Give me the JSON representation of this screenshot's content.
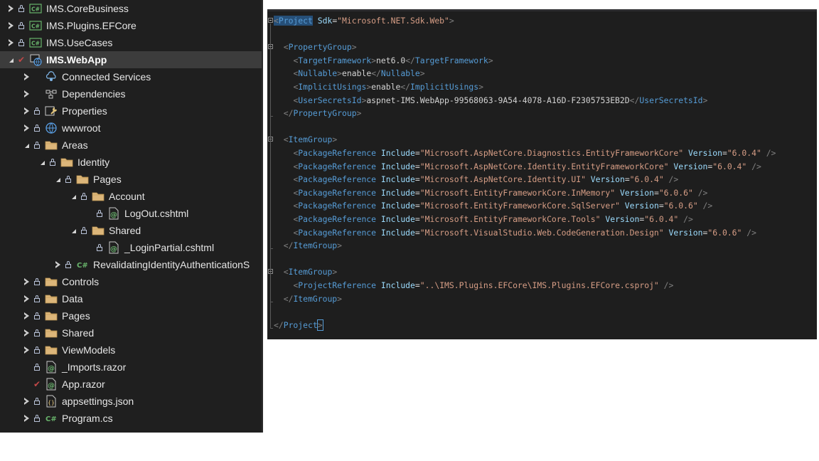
{
  "explorer": {
    "items": [
      {
        "label": "IMS.CoreBusiness",
        "depth": 0,
        "state": "collapsed",
        "mark": "lock",
        "icon": "csharp-project-icon"
      },
      {
        "label": "IMS.Plugins.EFCore",
        "depth": 0,
        "state": "collapsed",
        "mark": "lock",
        "icon": "csharp-project-icon"
      },
      {
        "label": "IMS.UseCases",
        "depth": 0,
        "state": "collapsed",
        "mark": "lock",
        "icon": "csharp-project-icon"
      },
      {
        "label": "IMS.WebApp",
        "depth": 0,
        "state": "expanded",
        "mark": "check",
        "icon": "web-project-icon",
        "selected": true
      },
      {
        "label": "Connected Services",
        "depth": 1,
        "state": "collapsed",
        "mark": "none",
        "icon": "connected-services-icon"
      },
      {
        "label": "Dependencies",
        "depth": 1,
        "state": "collapsed",
        "mark": "none",
        "icon": "dependencies-icon"
      },
      {
        "label": "Properties",
        "depth": 1,
        "state": "collapsed",
        "mark": "lock",
        "icon": "properties-wrench-icon"
      },
      {
        "label": "wwwroot",
        "depth": 1,
        "state": "collapsed",
        "mark": "lock",
        "icon": "globe-icon"
      },
      {
        "label": "Areas",
        "depth": 1,
        "state": "expanded",
        "mark": "lock",
        "icon": "folder-icon"
      },
      {
        "label": "Identity",
        "depth": 2,
        "state": "expanded",
        "mark": "lock",
        "icon": "folder-icon"
      },
      {
        "label": "Pages",
        "depth": 3,
        "state": "expanded",
        "mark": "lock",
        "icon": "folder-icon"
      },
      {
        "label": "Account",
        "depth": 4,
        "state": "expanded",
        "mark": "lock",
        "icon": "folder-icon"
      },
      {
        "label": "LogOut.cshtml",
        "depth": 5,
        "state": "none",
        "mark": "lock",
        "icon": "razor-file-icon"
      },
      {
        "label": "Shared",
        "depth": 4,
        "state": "expanded",
        "mark": "lock",
        "icon": "folder-icon"
      },
      {
        "label": "_LoginPartial.cshtml",
        "depth": 5,
        "state": "none",
        "mark": "lock",
        "icon": "razor-file-icon"
      },
      {
        "label": "RevalidatingIdentityAuthenticationS",
        "depth": 3,
        "state": "collapsed",
        "mark": "lock",
        "icon": "csharp-file-icon"
      },
      {
        "label": "Controls",
        "depth": 1,
        "state": "collapsed",
        "mark": "lock",
        "icon": "folder-icon"
      },
      {
        "label": "Data",
        "depth": 1,
        "state": "collapsed",
        "mark": "lock",
        "icon": "folder-icon"
      },
      {
        "label": "Pages",
        "depth": 1,
        "state": "collapsed",
        "mark": "lock",
        "icon": "folder-icon"
      },
      {
        "label": "Shared",
        "depth": 1,
        "state": "collapsed",
        "mark": "lock",
        "icon": "folder-icon"
      },
      {
        "label": "ViewModels",
        "depth": 1,
        "state": "collapsed",
        "mark": "lock",
        "icon": "folder-icon"
      },
      {
        "label": "_Imports.razor",
        "depth": 1,
        "state": "none",
        "mark": "lock",
        "icon": "razor-file-icon"
      },
      {
        "label": "App.razor",
        "depth": 1,
        "state": "none",
        "mark": "check",
        "icon": "razor-file-icon"
      },
      {
        "label": "appsettings.json",
        "depth": 1,
        "state": "collapsed",
        "mark": "lock",
        "icon": "json-file-icon"
      },
      {
        "label": "Program.cs",
        "depth": 1,
        "state": "collapsed",
        "mark": "lock",
        "icon": "csharp-file-icon"
      }
    ]
  },
  "editor": {
    "lines": [
      [
        [
          "br",
          "<"
        ],
        [
          "tag",
          "Project"
        ],
        [
          "txt",
          " "
        ],
        [
          "attr",
          "Sdk"
        ],
        [
          "eq",
          "="
        ],
        [
          "str",
          "\"Microsoft.NET.Sdk.Web\""
        ],
        [
          "br",
          ">"
        ]
      ],
      [],
      [
        [
          "txt",
          "  "
        ],
        [
          "br",
          "<"
        ],
        [
          "tag",
          "PropertyGroup"
        ],
        [
          "br",
          ">"
        ]
      ],
      [
        [
          "txt",
          "    "
        ],
        [
          "br",
          "<"
        ],
        [
          "tag",
          "TargetFramework"
        ],
        [
          "br",
          ">"
        ],
        [
          "txt",
          "net6.0"
        ],
        [
          "br",
          "</"
        ],
        [
          "tag",
          "TargetFramework"
        ],
        [
          "br",
          ">"
        ]
      ],
      [
        [
          "txt",
          "    "
        ],
        [
          "br",
          "<"
        ],
        [
          "tag",
          "Nullable"
        ],
        [
          "br",
          ">"
        ],
        [
          "txt",
          "enable"
        ],
        [
          "br",
          "</"
        ],
        [
          "tag",
          "Nullable"
        ],
        [
          "br",
          ">"
        ]
      ],
      [
        [
          "txt",
          "    "
        ],
        [
          "br",
          "<"
        ],
        [
          "tag",
          "ImplicitUsings"
        ],
        [
          "br",
          ">"
        ],
        [
          "txt",
          "enable"
        ],
        [
          "br",
          "</"
        ],
        [
          "tag",
          "ImplicitUsings"
        ],
        [
          "br",
          ">"
        ]
      ],
      [
        [
          "txt",
          "    "
        ],
        [
          "br",
          "<"
        ],
        [
          "tag",
          "UserSecretsId"
        ],
        [
          "br",
          ">"
        ],
        [
          "txt",
          "aspnet-IMS.WebApp-99568063-9A54-4078-A16D-F2305753EB2D"
        ],
        [
          "br",
          "</"
        ],
        [
          "tag",
          "UserSecretsId"
        ],
        [
          "br",
          ">"
        ]
      ],
      [
        [
          "txt",
          "  "
        ],
        [
          "br",
          "</"
        ],
        [
          "tag",
          "PropertyGroup"
        ],
        [
          "br",
          ">"
        ]
      ],
      [],
      [
        [
          "txt",
          "  "
        ],
        [
          "br",
          "<"
        ],
        [
          "tag",
          "ItemGroup"
        ],
        [
          "br",
          ">"
        ]
      ],
      [
        [
          "txt",
          "    "
        ],
        [
          "br",
          "<"
        ],
        [
          "tag",
          "PackageReference"
        ],
        [
          "txt",
          " "
        ],
        [
          "attr",
          "Include"
        ],
        [
          "eq",
          "="
        ],
        [
          "str",
          "\"Microsoft.AspNetCore.Diagnostics.EntityFrameworkCore\""
        ],
        [
          "txt",
          " "
        ],
        [
          "attr",
          "Version"
        ],
        [
          "eq",
          "="
        ],
        [
          "str",
          "\"6.0.4\""
        ],
        [
          "txt",
          " "
        ],
        [
          "br",
          "/>"
        ]
      ],
      [
        [
          "txt",
          "    "
        ],
        [
          "br",
          "<"
        ],
        [
          "tag",
          "PackageReference"
        ],
        [
          "txt",
          " "
        ],
        [
          "attr",
          "Include"
        ],
        [
          "eq",
          "="
        ],
        [
          "str",
          "\"Microsoft.AspNetCore.Identity.EntityFrameworkCore\""
        ],
        [
          "txt",
          " "
        ],
        [
          "attr",
          "Version"
        ],
        [
          "eq",
          "="
        ],
        [
          "str",
          "\"6.0.4\""
        ],
        [
          "txt",
          " "
        ],
        [
          "br",
          "/>"
        ]
      ],
      [
        [
          "txt",
          "    "
        ],
        [
          "br",
          "<"
        ],
        [
          "tag",
          "PackageReference"
        ],
        [
          "txt",
          " "
        ],
        [
          "attr",
          "Include"
        ],
        [
          "eq",
          "="
        ],
        [
          "str",
          "\"Microsoft.AspNetCore.Identity.UI\""
        ],
        [
          "txt",
          " "
        ],
        [
          "attr",
          "Version"
        ],
        [
          "eq",
          "="
        ],
        [
          "str",
          "\"6.0.4\""
        ],
        [
          "txt",
          " "
        ],
        [
          "br",
          "/>"
        ]
      ],
      [
        [
          "txt",
          "    "
        ],
        [
          "br",
          "<"
        ],
        [
          "tag",
          "PackageReference"
        ],
        [
          "txt",
          " "
        ],
        [
          "attr",
          "Include"
        ],
        [
          "eq",
          "="
        ],
        [
          "str",
          "\"Microsoft.EntityFrameworkCore.InMemory\""
        ],
        [
          "txt",
          " "
        ],
        [
          "attr",
          "Version"
        ],
        [
          "eq",
          "="
        ],
        [
          "str",
          "\"6.0.6\""
        ],
        [
          "txt",
          " "
        ],
        [
          "br",
          "/>"
        ]
      ],
      [
        [
          "txt",
          "    "
        ],
        [
          "br",
          "<"
        ],
        [
          "tag",
          "PackageReference"
        ],
        [
          "txt",
          " "
        ],
        [
          "attr",
          "Include"
        ],
        [
          "eq",
          "="
        ],
        [
          "str",
          "\"Microsoft.EntityFrameworkCore.SqlServer\""
        ],
        [
          "txt",
          " "
        ],
        [
          "attr",
          "Version"
        ],
        [
          "eq",
          "="
        ],
        [
          "str",
          "\"6.0.6\""
        ],
        [
          "txt",
          " "
        ],
        [
          "br",
          "/>"
        ]
      ],
      [
        [
          "txt",
          "    "
        ],
        [
          "br",
          "<"
        ],
        [
          "tag",
          "PackageReference"
        ],
        [
          "txt",
          " "
        ],
        [
          "attr",
          "Include"
        ],
        [
          "eq",
          "="
        ],
        [
          "str",
          "\"Microsoft.EntityFrameworkCore.Tools\""
        ],
        [
          "txt",
          " "
        ],
        [
          "attr",
          "Version"
        ],
        [
          "eq",
          "="
        ],
        [
          "str",
          "\"6.0.4\""
        ],
        [
          "txt",
          " "
        ],
        [
          "br",
          "/>"
        ]
      ],
      [
        [
          "txt",
          "    "
        ],
        [
          "br",
          "<"
        ],
        [
          "tag",
          "PackageReference"
        ],
        [
          "txt",
          " "
        ],
        [
          "attr",
          "Include"
        ],
        [
          "eq",
          "="
        ],
        [
          "str",
          "\"Microsoft.VisualStudio.Web.CodeGeneration.Design\""
        ],
        [
          "txt",
          " "
        ],
        [
          "attr",
          "Version"
        ],
        [
          "eq",
          "="
        ],
        [
          "str",
          "\"6.0.6\""
        ],
        [
          "txt",
          " "
        ],
        [
          "br",
          "/>"
        ]
      ],
      [
        [
          "txt",
          "  "
        ],
        [
          "br",
          "</"
        ],
        [
          "tag",
          "ItemGroup"
        ],
        [
          "br",
          ">"
        ]
      ],
      [],
      [
        [
          "txt",
          "  "
        ],
        [
          "br",
          "<"
        ],
        [
          "tag",
          "ItemGroup"
        ],
        [
          "br",
          ">"
        ]
      ],
      [
        [
          "txt",
          "    "
        ],
        [
          "br",
          "<"
        ],
        [
          "tag",
          "ProjectReference"
        ],
        [
          "txt",
          " "
        ],
        [
          "attr",
          "Include"
        ],
        [
          "eq",
          "="
        ],
        [
          "str",
          "\"..\\IMS.Plugins.EFCore\\IMS.Plugins.EFCore.csproj\""
        ],
        [
          "txt",
          " "
        ],
        [
          "br",
          "/>"
        ]
      ],
      [
        [
          "txt",
          "  "
        ],
        [
          "br",
          "</"
        ],
        [
          "tag",
          "ItemGroup"
        ],
        [
          "br",
          ">"
        ]
      ],
      [],
      [
        [
          "br",
          "</"
        ],
        [
          "tag",
          "Project"
        ],
        [
          "br",
          ">"
        ]
      ]
    ]
  }
}
